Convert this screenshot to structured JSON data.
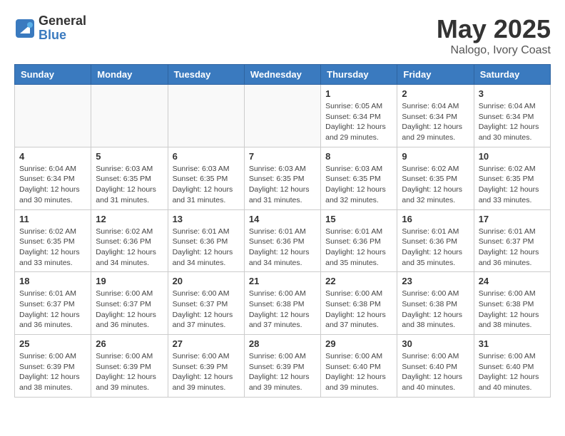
{
  "logo": {
    "general": "General",
    "blue": "Blue"
  },
  "title": "May 2025",
  "location": "Nalogo, Ivory Coast",
  "days_of_week": [
    "Sunday",
    "Monday",
    "Tuesday",
    "Wednesday",
    "Thursday",
    "Friday",
    "Saturday"
  ],
  "weeks": [
    [
      {
        "day": "",
        "info": ""
      },
      {
        "day": "",
        "info": ""
      },
      {
        "day": "",
        "info": ""
      },
      {
        "day": "",
        "info": ""
      },
      {
        "day": "1",
        "info": "Sunrise: 6:05 AM\nSunset: 6:34 PM\nDaylight: 12 hours\nand 29 minutes."
      },
      {
        "day": "2",
        "info": "Sunrise: 6:04 AM\nSunset: 6:34 PM\nDaylight: 12 hours\nand 29 minutes."
      },
      {
        "day": "3",
        "info": "Sunrise: 6:04 AM\nSunset: 6:34 PM\nDaylight: 12 hours\nand 30 minutes."
      }
    ],
    [
      {
        "day": "4",
        "info": "Sunrise: 6:04 AM\nSunset: 6:34 PM\nDaylight: 12 hours\nand 30 minutes."
      },
      {
        "day": "5",
        "info": "Sunrise: 6:03 AM\nSunset: 6:35 PM\nDaylight: 12 hours\nand 31 minutes."
      },
      {
        "day": "6",
        "info": "Sunrise: 6:03 AM\nSunset: 6:35 PM\nDaylight: 12 hours\nand 31 minutes."
      },
      {
        "day": "7",
        "info": "Sunrise: 6:03 AM\nSunset: 6:35 PM\nDaylight: 12 hours\nand 31 minutes."
      },
      {
        "day": "8",
        "info": "Sunrise: 6:03 AM\nSunset: 6:35 PM\nDaylight: 12 hours\nand 32 minutes."
      },
      {
        "day": "9",
        "info": "Sunrise: 6:02 AM\nSunset: 6:35 PM\nDaylight: 12 hours\nand 32 minutes."
      },
      {
        "day": "10",
        "info": "Sunrise: 6:02 AM\nSunset: 6:35 PM\nDaylight: 12 hours\nand 33 minutes."
      }
    ],
    [
      {
        "day": "11",
        "info": "Sunrise: 6:02 AM\nSunset: 6:35 PM\nDaylight: 12 hours\nand 33 minutes."
      },
      {
        "day": "12",
        "info": "Sunrise: 6:02 AM\nSunset: 6:36 PM\nDaylight: 12 hours\nand 34 minutes."
      },
      {
        "day": "13",
        "info": "Sunrise: 6:01 AM\nSunset: 6:36 PM\nDaylight: 12 hours\nand 34 minutes."
      },
      {
        "day": "14",
        "info": "Sunrise: 6:01 AM\nSunset: 6:36 PM\nDaylight: 12 hours\nand 34 minutes."
      },
      {
        "day": "15",
        "info": "Sunrise: 6:01 AM\nSunset: 6:36 PM\nDaylight: 12 hours\nand 35 minutes."
      },
      {
        "day": "16",
        "info": "Sunrise: 6:01 AM\nSunset: 6:36 PM\nDaylight: 12 hours\nand 35 minutes."
      },
      {
        "day": "17",
        "info": "Sunrise: 6:01 AM\nSunset: 6:37 PM\nDaylight: 12 hours\nand 36 minutes."
      }
    ],
    [
      {
        "day": "18",
        "info": "Sunrise: 6:01 AM\nSunset: 6:37 PM\nDaylight: 12 hours\nand 36 minutes."
      },
      {
        "day": "19",
        "info": "Sunrise: 6:00 AM\nSunset: 6:37 PM\nDaylight: 12 hours\nand 36 minutes."
      },
      {
        "day": "20",
        "info": "Sunrise: 6:00 AM\nSunset: 6:37 PM\nDaylight: 12 hours\nand 37 minutes."
      },
      {
        "day": "21",
        "info": "Sunrise: 6:00 AM\nSunset: 6:38 PM\nDaylight: 12 hours\nand 37 minutes."
      },
      {
        "day": "22",
        "info": "Sunrise: 6:00 AM\nSunset: 6:38 PM\nDaylight: 12 hours\nand 37 minutes."
      },
      {
        "day": "23",
        "info": "Sunrise: 6:00 AM\nSunset: 6:38 PM\nDaylight: 12 hours\nand 38 minutes."
      },
      {
        "day": "24",
        "info": "Sunrise: 6:00 AM\nSunset: 6:38 PM\nDaylight: 12 hours\nand 38 minutes."
      }
    ],
    [
      {
        "day": "25",
        "info": "Sunrise: 6:00 AM\nSunset: 6:39 PM\nDaylight: 12 hours\nand 38 minutes."
      },
      {
        "day": "26",
        "info": "Sunrise: 6:00 AM\nSunset: 6:39 PM\nDaylight: 12 hours\nand 39 minutes."
      },
      {
        "day": "27",
        "info": "Sunrise: 6:00 AM\nSunset: 6:39 PM\nDaylight: 12 hours\nand 39 minutes."
      },
      {
        "day": "28",
        "info": "Sunrise: 6:00 AM\nSunset: 6:39 PM\nDaylight: 12 hours\nand 39 minutes."
      },
      {
        "day": "29",
        "info": "Sunrise: 6:00 AM\nSunset: 6:40 PM\nDaylight: 12 hours\nand 39 minutes."
      },
      {
        "day": "30",
        "info": "Sunrise: 6:00 AM\nSunset: 6:40 PM\nDaylight: 12 hours\nand 40 minutes."
      },
      {
        "day": "31",
        "info": "Sunrise: 6:00 AM\nSunset: 6:40 PM\nDaylight: 12 hours\nand 40 minutes."
      }
    ]
  ]
}
